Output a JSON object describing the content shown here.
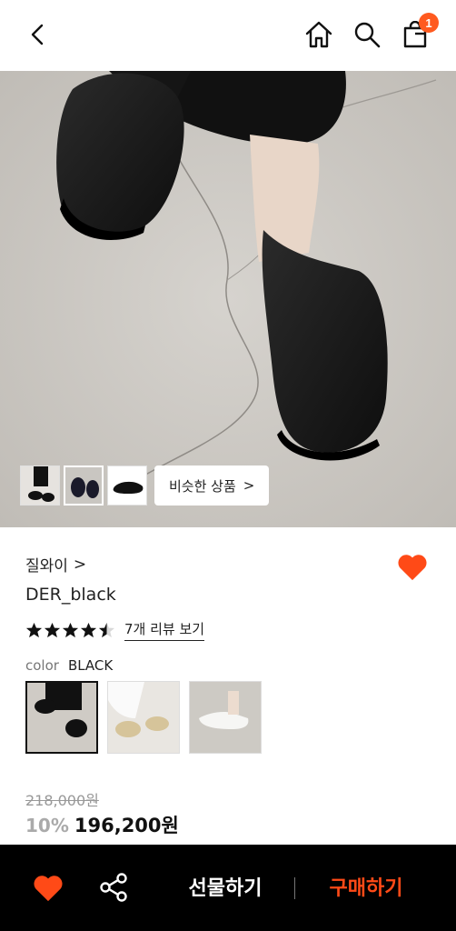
{
  "header": {
    "back_icon": "chevron-left-icon",
    "home_icon": "home-icon",
    "search_icon": "search-icon",
    "cart_icon": "shopping-bag-icon",
    "cart_badge": "1",
    "accent_color": "#ff5a1f"
  },
  "gallery": {
    "thumbnails": [
      "thumb-1",
      "thumb-2",
      "thumb-3"
    ],
    "similar_label": "비슷한 상품",
    "similar_chevron": ">"
  },
  "product": {
    "brand": "질와이",
    "brand_chevron": ">",
    "name": "DER_black",
    "rating": 4.5,
    "rating_max": 5,
    "review_link": "7개 리뷰 보기",
    "color_label": "color",
    "color_value": "BLACK",
    "swatches": [
      "black",
      "beige",
      "white"
    ],
    "original_price": "218,000원",
    "discount": "10%",
    "final_price": "196,200원",
    "wish_color": "#ff4a17"
  },
  "bottom_bar": {
    "heart_icon": "heart-icon",
    "share_icon": "share-icon",
    "gift_label": "선물하기",
    "buy_label": "구매하기",
    "buy_color": "#ff4a17"
  }
}
